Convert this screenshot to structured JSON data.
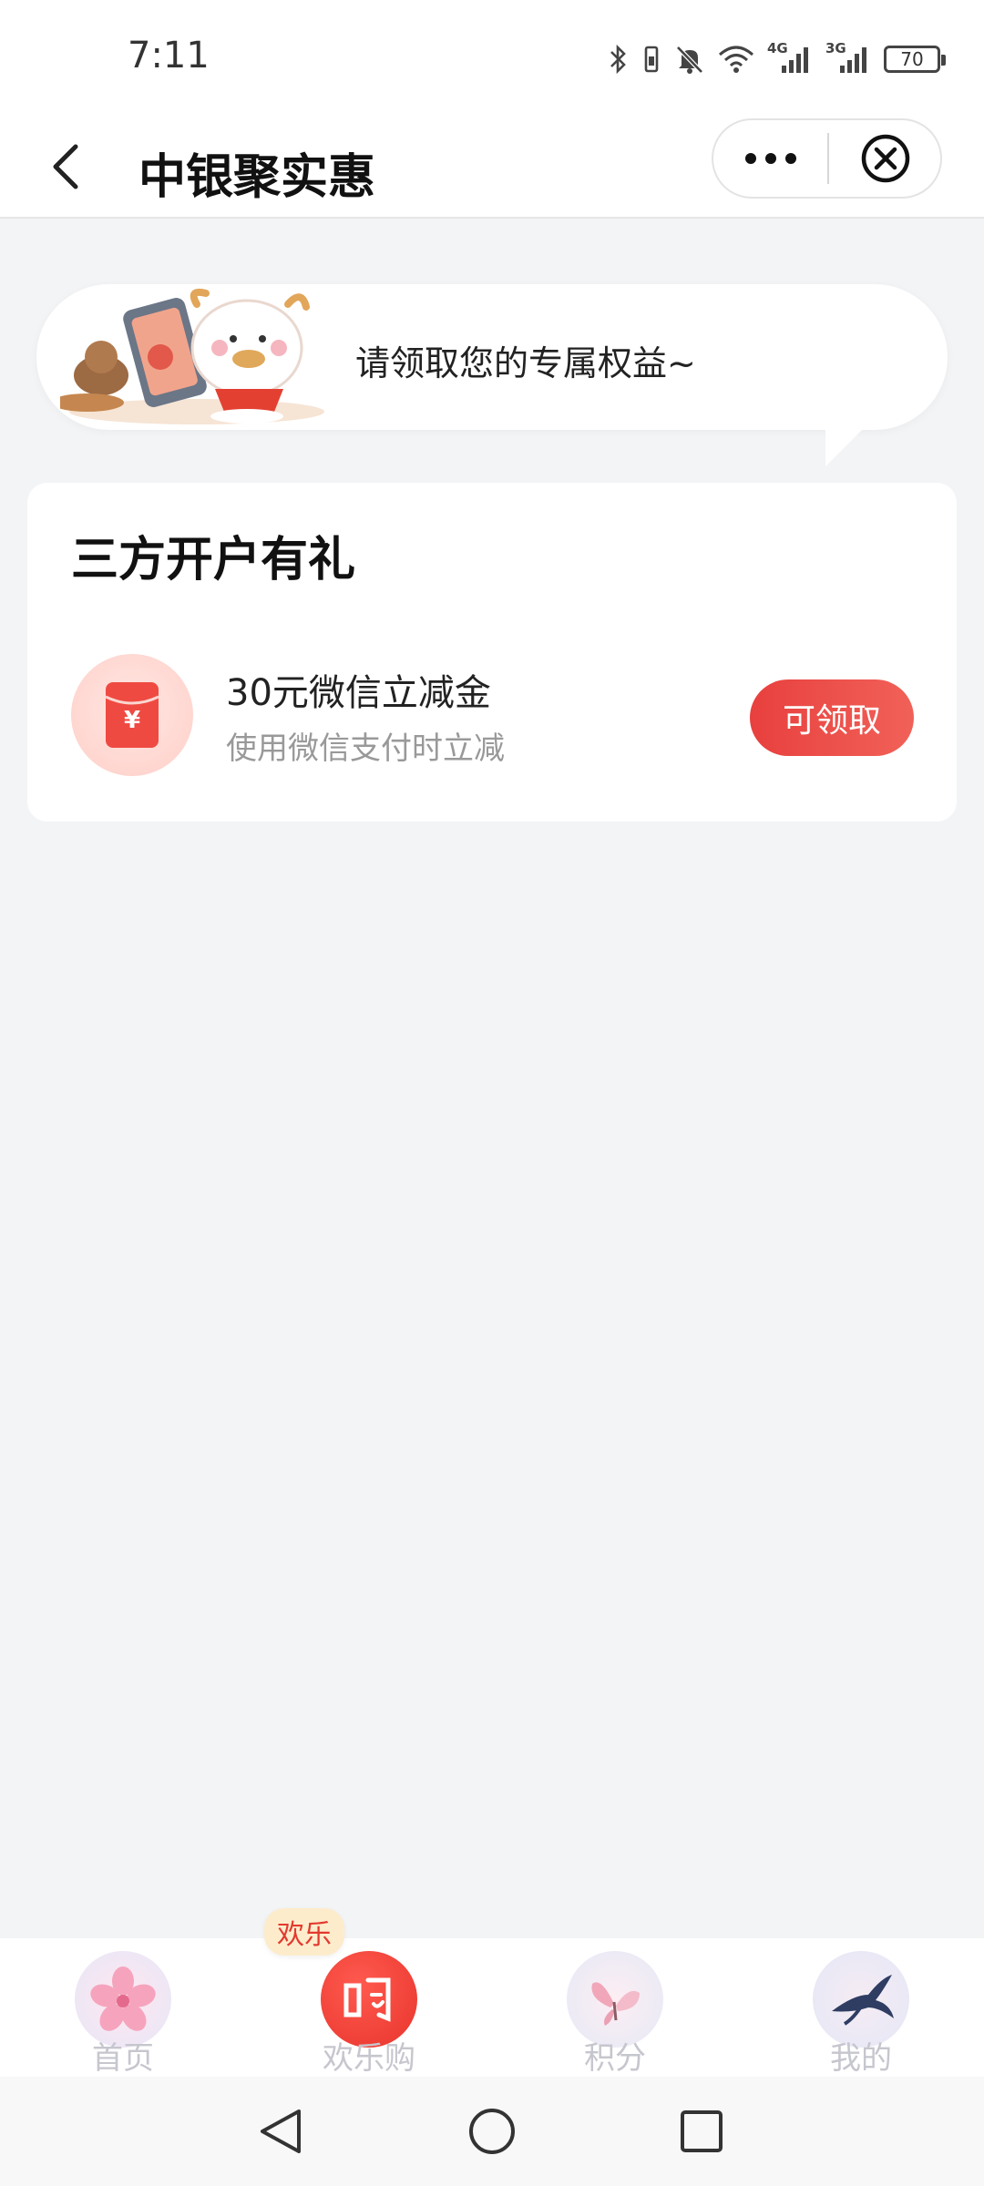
{
  "status_bar": {
    "time": "7:11",
    "network_1": "4G",
    "network_2": "3G",
    "battery": "70",
    "icons": [
      "bluetooth-icon",
      "vibrate-icon",
      "mute-icon",
      "wifi-icon",
      "signal-icon",
      "signal-icon",
      "battery-icon"
    ]
  },
  "nav": {
    "title": "中银聚实惠",
    "icons": [
      "back-icon",
      "more-icon",
      "close-icon"
    ]
  },
  "banner": {
    "text": "请领取您的专属权益~"
  },
  "card": {
    "title": "三方开户有礼",
    "coupon": {
      "name": "30元微信立减金",
      "description": "使用微信支付时立减",
      "button": "可领取",
      "icon": "red-envelope-icon"
    }
  },
  "tab_bar": {
    "badge": "欢乐",
    "items": [
      {
        "label": "首页",
        "icon": "cherry-blossom-icon"
      },
      {
        "label": "欢乐购",
        "icon": "shopping-icon"
      },
      {
        "label": "积分",
        "icon": "butterfly-icon"
      },
      {
        "label": "我的",
        "icon": "swallow-icon"
      }
    ]
  },
  "colors": {
    "accent": "#e8403e",
    "background": "#f3f4f6",
    "tab_label": "#c6c6ce"
  }
}
